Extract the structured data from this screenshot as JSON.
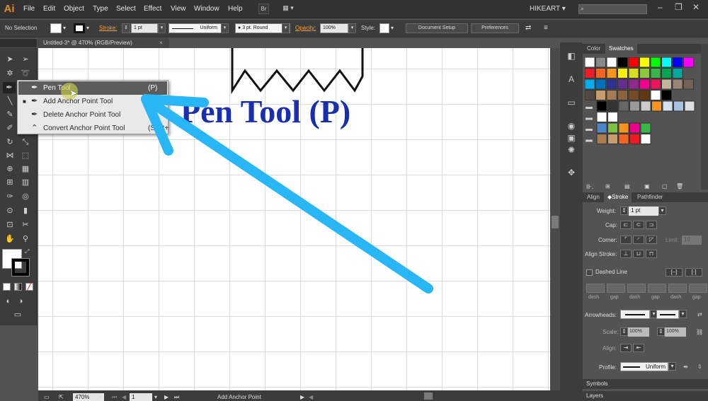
{
  "app": {
    "logo": "Ai"
  },
  "menu": {
    "items": [
      "File",
      "Edit",
      "Object",
      "Type",
      "Select",
      "Effect",
      "View",
      "Window",
      "Help"
    ],
    "bridge": "Br",
    "arrange": "▦ ▾",
    "workspace": "HIKEART ▾"
  },
  "control": {
    "selection": "No Selection",
    "stroke_label": "Stroke:",
    "stroke_weight": "1 pt",
    "profile": "Uniform",
    "brush": "3 pt. Round",
    "opacity_label": "Opacity:",
    "opacity": "100%",
    "style_label": "Style:",
    "doc_setup": "Document Setup",
    "preferences": "Preferences"
  },
  "document": {
    "tab": "Untitled-3* @ 470% (RGB/Preview)",
    "close": "×",
    "heading": "Pen Tool (P)"
  },
  "flyout": {
    "items": [
      {
        "label": "Pen Tool",
        "shortcut": "(P)",
        "icon": "pen-icon"
      },
      {
        "label": "Add Anchor Point Tool",
        "shortcut": "",
        "icon": "add-anchor-icon"
      },
      {
        "label": "Delete Anchor Point Tool",
        "shortcut": "",
        "icon": "delete-anchor-icon"
      },
      {
        "label": "Convert Anchor Point Tool",
        "shortcut": "(Shift+",
        "icon": "convert-anchor-icon"
      }
    ]
  },
  "status": {
    "zoom": "470%",
    "page": "1",
    "tool": "Add Anchor Point"
  },
  "panels": {
    "tabs_top": [
      "Color",
      "Swatches"
    ],
    "tabs_stroke": [
      "Align",
      "◆Stroke",
      "Pathfinder"
    ],
    "stroke": {
      "weight_label": "Weight:",
      "weight": "1 pt",
      "cap_label": "Cap:",
      "corner_label": "Corner:",
      "limit_label": "Limit:",
      "limit": "10",
      "align_label": "Align Stroke:",
      "dashed_label": "Dashed Line",
      "dash_labels": [
        "dash",
        "gap",
        "dash",
        "gap",
        "dash",
        "gap"
      ],
      "arrowheads_label": "Arrowheads:",
      "scale_label": "Scale:",
      "scale1": "100%",
      "scale2": "100%",
      "align2_label": "Align:",
      "profile_label": "Profile:",
      "profile": "Uniform"
    },
    "symbols": "Symbols",
    "layers": "Layers"
  },
  "colors": {
    "accent_arrow": "#29b6f6",
    "heading": "#1a2eb0",
    "highlight": "#c8d04a"
  }
}
